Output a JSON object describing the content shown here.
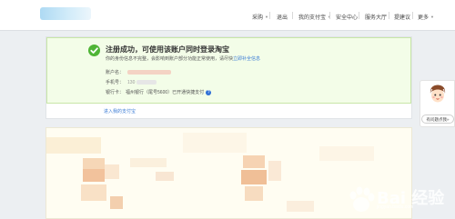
{
  "nav": {
    "items": [
      {
        "label": "采购",
        "has_caret": true
      },
      {
        "label": "退出",
        "has_caret": false
      },
      {
        "label": "我的支付宝",
        "has_caret": true
      },
      {
        "label": "安全中心",
        "has_caret": false
      },
      {
        "label": "服务大厅",
        "has_caret": false
      },
      {
        "label": "提建议",
        "has_caret": false
      },
      {
        "label": "更多",
        "has_caret": true
      }
    ]
  },
  "success": {
    "title": "注册成功，可使用该账户同时登录淘宝",
    "subtitle": "你的身份信息不完整，会影响到账户部分功能正常使用，请尽快",
    "subtitle_link": "立即补全信息",
    "account_label": "账户名：",
    "phone_label": "手机号：",
    "phone_partial": "130",
    "bank_label": "银行卡：",
    "bank_value": "福州银行（尾号5600）已开通快捷支付",
    "help_icon": "question-icon"
  },
  "links": {
    "cashier": "进入我的支付宝"
  },
  "feedback": {
    "button_label": "有问题点我»",
    "avatar_icon": "cartoon-avatar-icon"
  },
  "watermark": {
    "text": "Bai 经验",
    "url": "jingyan.baidu.com"
  },
  "colors": {
    "success_bg": "#f3fde8",
    "success_check": "#4fb536",
    "link": "#3a7bd5"
  }
}
